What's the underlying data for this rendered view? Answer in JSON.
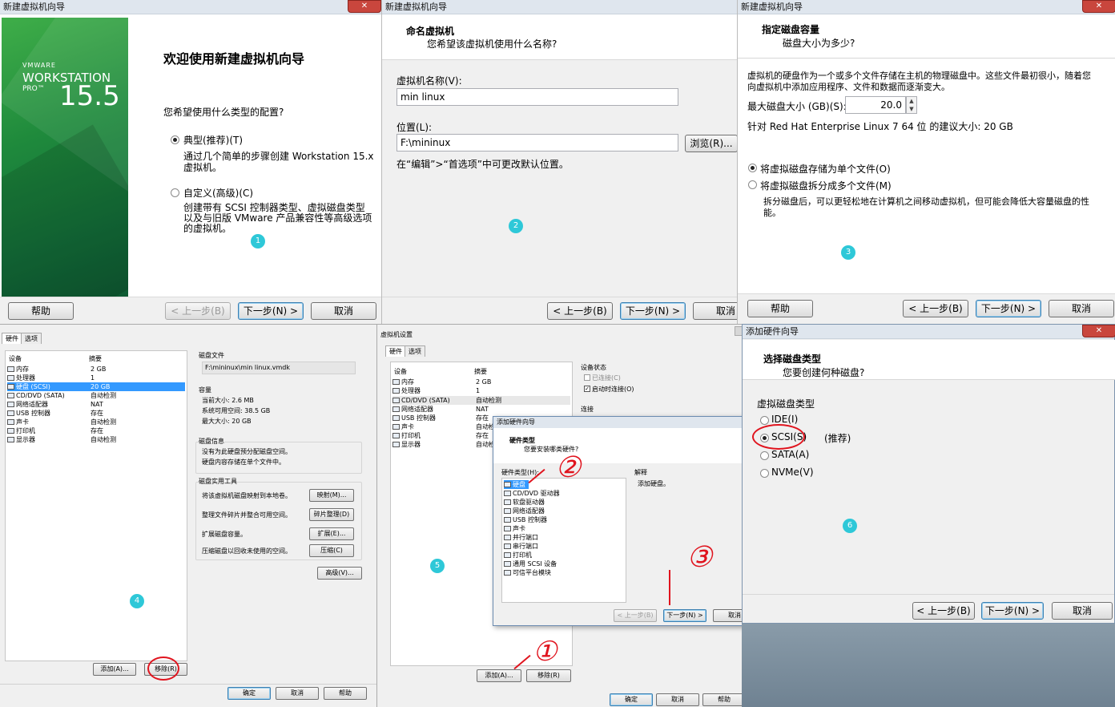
{
  "p1": {
    "title": "新建虚拟机向导",
    "logo_vmware": "VMWARE",
    "logo_workstation": "WORKSTATION",
    "logo_pro": "PRO™",
    "logo_version": "15.5",
    "heading": "欢迎使用新建虚拟机向导",
    "question": "您希望使用什么类型的配置?",
    "opt1_label": "典型(推荐)(T)",
    "opt1_desc1": "通过几个简单的步骤创建 Workstation 15.x",
    "opt1_desc2": "虚拟机。",
    "opt2_label": "自定义(高级)(C)",
    "opt2_desc1": "创建带有 SCSI 控制器类型、虚拟磁盘类型",
    "opt2_desc2": "以及与旧版 VMware 产品兼容性等高级选项",
    "opt2_desc3": "的虚拟机。",
    "badge": "1",
    "help": "帮助",
    "back": "< 上一步(B)",
    "next": "下一步(N) >",
    "cancel": "取消"
  },
  "p2": {
    "title": "新建虚拟机向导",
    "heading": "命名虚拟机",
    "subheading": "您希望该虚拟机使用什么名称?",
    "name_label": "虚拟机名称(V):",
    "name_value": "min linux",
    "loc_label": "位置(L):",
    "loc_value": "F:\\mininux",
    "browse": "浏览(R)...",
    "hint": "在“编辑”>“首选项”中可更改默认位置。",
    "badge": "2",
    "back": "< 上一步(B)",
    "next": "下一步(N) >",
    "cancel": "取消"
  },
  "p3": {
    "title": "新建虚拟机向导",
    "heading": "指定磁盘容量",
    "subheading": "磁盘大小为多少?",
    "desc1": "虚拟机的硬盘作为一个或多个文件存储在主机的物理磁盘中。这些文件最初很小，随着您",
    "desc2": "向虚拟机中添加应用程序、文件和数据而逐渐变大。",
    "size_label": "最大磁盘大小 (GB)(S):",
    "size_value": "20.0",
    "recommend": "针对 Red Hat Enterprise Linux 7 64 位 的建议大小: 20 GB",
    "opt1": "将虚拟磁盘存储为单个文件(O)",
    "opt2": "将虚拟磁盘拆分成多个文件(M)",
    "opt2_desc1": "拆分磁盘后，可以更轻松地在计算机之间移动虚拟机，但可能会降低大容量磁盘的性",
    "opt2_desc2": "能。",
    "badge": "3",
    "help": "帮助",
    "back": "< 上一步(B)",
    "next": "下一步(N) >",
    "cancel": "取消"
  },
  "p4": {
    "tab_hw": "硬件",
    "tab_opt": "选项",
    "col_device": "设备",
    "col_summary": "摘要",
    "devices": [
      {
        "name": "内存",
        "summary": "2 GB"
      },
      {
        "name": "处理器",
        "summary": "1"
      },
      {
        "name": "硬盘 (SCSI)",
        "summary": "20 GB"
      },
      {
        "name": "CD/DVD (SATA)",
        "summary": "自动检测"
      },
      {
        "name": "网络适配器",
        "summary": "NAT"
      },
      {
        "name": "USB 控制器",
        "summary": "存在"
      },
      {
        "name": "声卡",
        "summary": "自动检测"
      },
      {
        "name": "打印机",
        "summary": "存在"
      },
      {
        "name": "显示器",
        "summary": "自动检测"
      }
    ],
    "diskfile_title": "磁盘文件",
    "diskfile_value": "F:\\mininux\\min linux.vmdk",
    "capacity_title": "容量",
    "cap1": "当前大小: 2.6 MB",
    "cap2": "系统可用空间: 38.5 GB",
    "cap3": "最大大小: 20 GB",
    "diskinfo_title": "磁盘信息",
    "info1": "没有为此硬盘预分配磁盘空间。",
    "info2": "硬盘内容存储在单个文件中。",
    "tools_title": "磁盘实用工具",
    "tool1": "将该虚拟机磁盘映射到本地卷。",
    "tool1_btn": "映射(M)...",
    "tool2": "整理文件碎片并整合可用空间。",
    "tool2_btn": "碎片整理(D)",
    "tool3": "扩展磁盘容量。",
    "tool3_btn": "扩展(E)...",
    "tool4": "压缩磁盘以回收未使用的空间。",
    "tool4_btn": "压缩(C)",
    "advanced": "高级(V)...",
    "add": "添加(A)...",
    "remove": "移除(R)",
    "ok": "确定",
    "cancel": "取消",
    "help": "帮助",
    "badge": "4"
  },
  "p5": {
    "title": "虚拟机设置",
    "tab_hw": "硬件",
    "tab_opt": "选项",
    "col_device": "设备",
    "col_summary": "摘要",
    "devices": [
      {
        "name": "内存",
        "summary": "2 GB"
      },
      {
        "name": "处理器",
        "summary": "1"
      },
      {
        "name": "CD/DVD (SATA)",
        "summary": "自动检测"
      },
      {
        "name": "网络适配器",
        "summary": "NAT"
      },
      {
        "name": "USB 控制器",
        "summary": "存在"
      },
      {
        "name": "声卡",
        "summary": "自动检"
      },
      {
        "name": "打印机",
        "summary": "存在"
      },
      {
        "name": "显示器",
        "summary": "自动检"
      }
    ],
    "status_title": "设备状态",
    "connected": "已连接(C)",
    "connect_on": "启动时连接(O)",
    "conn_title": "连接",
    "add": "添加(A)...",
    "remove": "移除(R)",
    "ok": "确定",
    "cancel": "取消",
    "help": "帮助",
    "badge": "5",
    "dlg": {
      "title": "添加硬件向导",
      "heading": "硬件类型",
      "subheading": "您要安装哪类硬件?",
      "list_label": "硬件类型(H):",
      "explain_label": "解释",
      "explain_text": "添加硬盘。",
      "items": [
        "硬盘",
        "CD/DVD 驱动器",
        "软盘驱动器",
        "网络适配器",
        "USB 控制器",
        "声卡",
        "并行端口",
        "串行端口",
        "打印机",
        "通用 SCSI 设备",
        "可信平台模块"
      ],
      "back": "< 上一步(B)",
      "next": "下一步(N) >",
      "cancel": "取消"
    },
    "annot1": "①",
    "annot2": "②",
    "annot3": "③"
  },
  "p6": {
    "title": "添加硬件向导",
    "heading": "选择磁盘类型",
    "subheading": "您要创建何种磁盘?",
    "group": "虚拟磁盘类型",
    "opt_ide": "IDE(I)",
    "opt_scsi": "SCSI(S)",
    "recommend": "(推荐)",
    "opt_sata": "SATA(A)",
    "opt_nvme": "NVMe(V)",
    "badge": "6",
    "back": "< 上一步(B)",
    "next": "下一步(N) >",
    "cancel": "取消"
  }
}
